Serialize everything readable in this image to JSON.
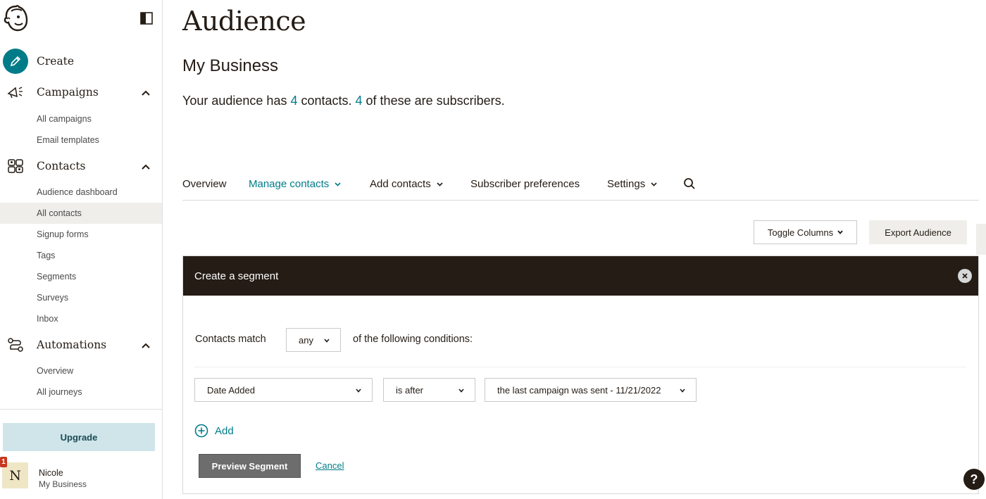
{
  "sidebar": {
    "create_label": "Create",
    "sections": [
      {
        "label": "Campaigns",
        "items": [
          "All campaigns",
          "Email templates"
        ]
      },
      {
        "label": "Contacts",
        "items": [
          "Audience dashboard",
          "All contacts",
          "Signup forms",
          "Tags",
          "Segments",
          "Surveys",
          "Inbox"
        ]
      },
      {
        "label": "Automations",
        "items": [
          "Overview",
          "All journeys"
        ]
      }
    ],
    "active_item": "All contacts",
    "upgrade_label": "Upgrade",
    "user": {
      "initial": "N",
      "name": "Nicole",
      "org": "My Business",
      "notification_count": "1"
    }
  },
  "page": {
    "title": "Audience",
    "business_name": "My Business",
    "summary": {
      "prefix": "Your audience has ",
      "contacts": "4",
      "middle": " contacts. ",
      "subscribers": "4",
      "suffix": " of these are subscribers."
    }
  },
  "tabs": [
    {
      "label": "Overview"
    },
    {
      "label": "Manage contacts"
    },
    {
      "label": "Add contacts"
    },
    {
      "label": "Subscriber preferences"
    },
    {
      "label": "Settings"
    }
  ],
  "toolbar": {
    "toggle_columns": "Toggle Columns",
    "export_audience": "Export Audience"
  },
  "segment": {
    "title": "Create a segment",
    "match_label": "Contacts match",
    "match_value": "any",
    "match_after": "of the following conditions:",
    "condition": {
      "field": "Date Added",
      "operator": "is after",
      "value": "the last campaign was sent - 11/21/2022"
    },
    "add_label": "Add",
    "preview_label": "Preview Segment",
    "cancel_label": "Cancel"
  },
  "help_label": "?",
  "colors": {
    "accent": "#007c89",
    "dark": "#241c15",
    "upgrade_bg": "#cfe5ea",
    "active_bg": "#efeeea"
  },
  "icons": [
    "freddie-logo-icon",
    "sidebar-toggle-icon",
    "pencil-icon",
    "megaphone-icon",
    "contacts-icon",
    "automations-icon",
    "chevron-up-icon",
    "chevron-down-icon",
    "search-icon",
    "close-icon",
    "plus-circle-icon",
    "help-icon"
  ]
}
